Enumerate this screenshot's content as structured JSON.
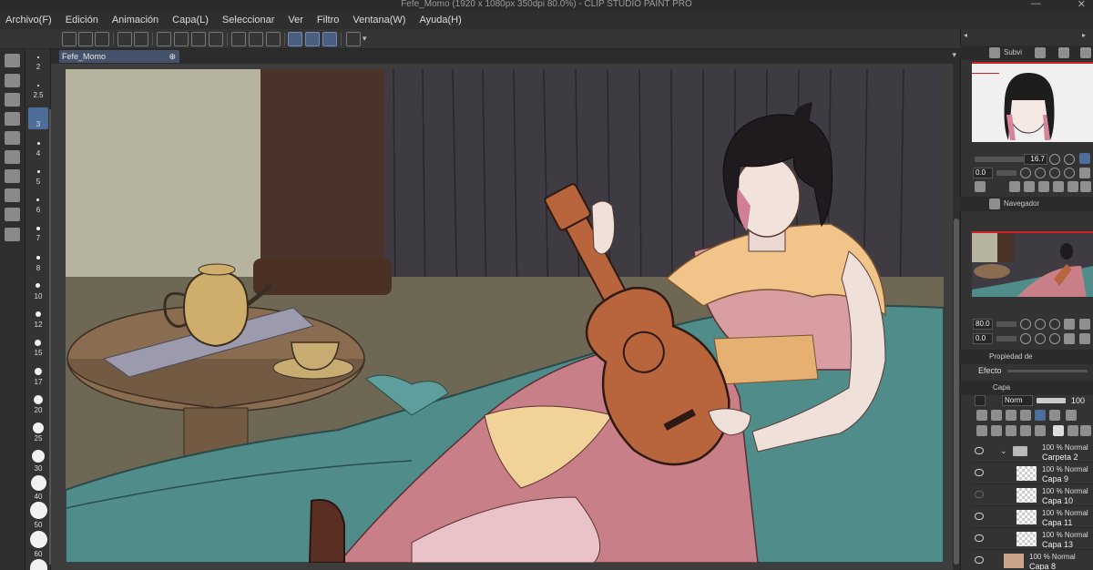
{
  "window": {
    "title": "Fefe_Momo (1920 x 1080px 350dpi 80.0%)  - CLIP STUDIO PAINT PRO",
    "minimize": "—",
    "close": "✕"
  },
  "menu": [
    "Archivo(F)",
    "Edición",
    "Animación",
    "Capa(L)",
    "Seleccionar",
    "Ver",
    "Filtro",
    "Ventana(W)",
    "Ayuda(H)"
  ],
  "canvas_tab": {
    "label": "Fefe_Momo"
  },
  "brush_sizes": [
    "2",
    "2.5",
    "3",
    "4",
    "5",
    "6",
    "7",
    "8",
    "10",
    "12",
    "15",
    "17",
    "20",
    "25",
    "30",
    "40",
    "50",
    "60"
  ],
  "brush_selected": "3",
  "panels": {
    "subview_tab": "Subvi",
    "navigator_tab": "Navegador",
    "subview_zoom": "16.7",
    "subview_rotation": "0.0",
    "navigator_zoom": "80.0",
    "navigator_rotation": "0.0",
    "tool_property_tab": "Propiedad de",
    "effect_label": "Efecto",
    "layer_tab": "Capa",
    "blend_mode": "Norm",
    "opacity": "100"
  },
  "layers": [
    {
      "line1": "100 % Normal",
      "line2": "Carpeta 2",
      "type": "folder"
    },
    {
      "line1": "100 % Normal",
      "line2": "Capa 9",
      "type": "raster"
    },
    {
      "line1": "100 % Normal",
      "line2": "Capa 10",
      "type": "raster"
    },
    {
      "line1": "100 % Normal",
      "line2": "Capa 11",
      "type": "raster"
    },
    {
      "line1": "100 % Normal",
      "line2": "Capa 13",
      "type": "raster"
    },
    {
      "line1": "100 % Normal",
      "line2": "Capa 8",
      "type": "raster"
    }
  ],
  "colors": {
    "accent": "#4d6e99",
    "panel": "#333333",
    "menubar": "#2f2f2f"
  }
}
